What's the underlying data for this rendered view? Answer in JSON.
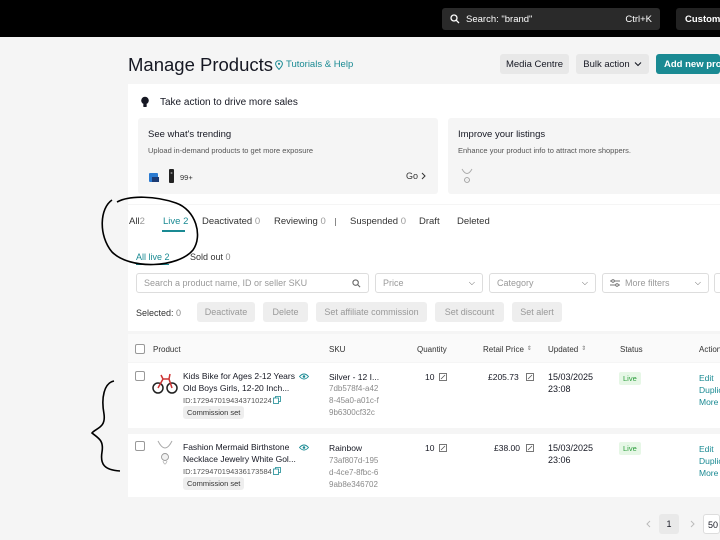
{
  "topbar": {
    "search_text": "Search: \"brand\"",
    "shortcut": "Ctrl+K",
    "account": "Customer"
  },
  "header": {
    "title": "Manage Products",
    "tutorials": "Tutorials & Help",
    "media_centre": "Media Centre",
    "bulk_action": "Bulk action",
    "add_new": "Add new product"
  },
  "sales": {
    "heading": "Take action to drive more sales",
    "trending": {
      "title": "See what's trending",
      "desc": "Upload in-demand products to get more exposure",
      "count": "99+",
      "go": "Go"
    },
    "improve": {
      "title": "Improve your listings",
      "desc": "Enhance your product info to attract more shoppers."
    }
  },
  "tabs": [
    {
      "label": "All",
      "count": "2"
    },
    {
      "label": "Live",
      "count": "2"
    },
    {
      "label": "Deactivated",
      "count": "0"
    },
    {
      "label": "Reviewing",
      "count": "0"
    },
    {
      "label": "Suspended",
      "count": "0"
    },
    {
      "label": "Draft",
      "count": ""
    },
    {
      "label": "Deleted",
      "count": ""
    }
  ],
  "subtabs": [
    {
      "label": "All live",
      "count": "2"
    },
    {
      "label": "Sold out",
      "count": "0"
    }
  ],
  "filters": {
    "search_placeholder": "Search a product name, ID or seller SKU",
    "price": "Price",
    "category": "Category",
    "more_filters": "More filters"
  },
  "bulk": {
    "selected_label": "Selected:",
    "selected_count": "0",
    "deactivate": "Deactivate",
    "delete": "Delete",
    "set_affiliate": "Set affiliate commission",
    "set_discount": "Set discount",
    "set_alert": "Set alert"
  },
  "table": {
    "headers": [
      "Product",
      "SKU",
      "Quantity",
      "Retail Price",
      "Updated",
      "Status",
      "Actions"
    ],
    "rows": [
      {
        "name": "Kids Bike for Ages 2-12 Years Old Boys Girls, 12-20 Inch...",
        "id": "ID:1729470194343710224",
        "badge": "Commission set",
        "sku_name": "Silver - 12 I...",
        "sku_lines": [
          "7db578f4-a42",
          "8-45a0-a01c-f",
          "9b6300cf32c"
        ],
        "quantity": "10",
        "price": "£205.73",
        "updated": [
          "15/03/2025",
          "23:08"
        ],
        "status": "Live",
        "actions": [
          "Edit",
          "Duplicate",
          "More"
        ]
      },
      {
        "name": "Fashion Mermaid Birthstone Necklace Jewelry White Gol...",
        "id": "ID:1729470194336173584",
        "badge": "Commission set",
        "sku_name": "Rainbow",
        "sku_lines": [
          "73af807d-195",
          "d-4ce7-8fbc-6",
          "9ab8e346702"
        ],
        "quantity": "10",
        "price": "£38.00",
        "updated": [
          "15/03/2025",
          "23:06"
        ],
        "status": "Live",
        "actions": [
          "Edit",
          "Duplicate",
          "More"
        ]
      }
    ]
  },
  "pagination": {
    "page": "1",
    "per_page": "50"
  },
  "colors": {
    "accent": "#1a8a93",
    "live_green": "#2a9d3a",
    "topbar": "#000000",
    "annotation_ink": "#000000"
  }
}
